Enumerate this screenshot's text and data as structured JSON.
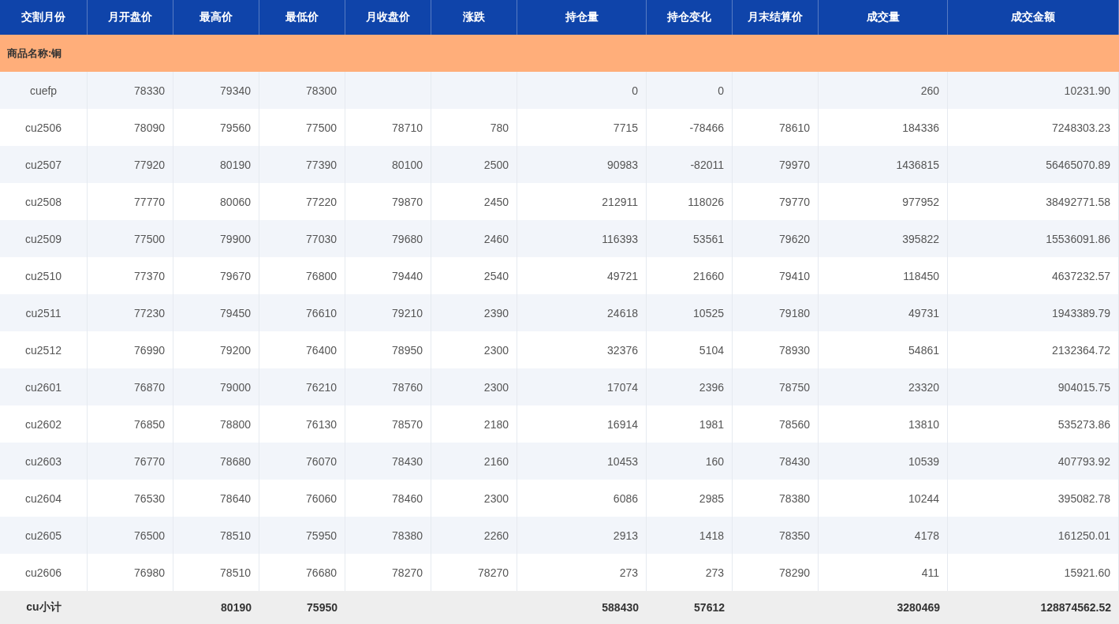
{
  "table": {
    "columns": [
      "交割月份",
      "月开盘价",
      "最高价",
      "最低价",
      "月收盘价",
      "涨跌",
      "持仓量",
      "持仓变化",
      "月末结算价",
      "成交量",
      "成交金额"
    ],
    "group": "商品名称:铜",
    "rows": [
      {
        "kind": "data",
        "cells": [
          "cuefp",
          "78330",
          "79340",
          "78300",
          null,
          null,
          "0",
          "0",
          null,
          "260",
          "10231.90"
        ]
      },
      {
        "kind": "data",
        "cells": [
          "cu2506",
          "78090",
          "79560",
          "77500",
          "78710",
          "780",
          "7715",
          "-78466",
          "78610",
          "184336",
          "7248303.23"
        ]
      },
      {
        "kind": "data",
        "cells": [
          "cu2507",
          "77920",
          "80190",
          "77390",
          "80100",
          "2500",
          "90983",
          "-82011",
          "79970",
          "1436815",
          "56465070.89"
        ]
      },
      {
        "kind": "data",
        "cells": [
          "cu2508",
          "77770",
          "80060",
          "77220",
          "79870",
          "2450",
          "212911",
          "118026",
          "79770",
          "977952",
          "38492771.58"
        ]
      },
      {
        "kind": "data",
        "cells": [
          "cu2509",
          "77500",
          "79900",
          "77030",
          "79680",
          "2460",
          "116393",
          "53561",
          "79620",
          "395822",
          "15536091.86"
        ]
      },
      {
        "kind": "data",
        "cells": [
          "cu2510",
          "77370",
          "79670",
          "76800",
          "79440",
          "2540",
          "49721",
          "21660",
          "79410",
          "118450",
          "4637232.57"
        ]
      },
      {
        "kind": "data",
        "cells": [
          "cu2511",
          "77230",
          "79450",
          "76610",
          "79210",
          "2390",
          "24618",
          "10525",
          "79180",
          "49731",
          "1943389.79"
        ]
      },
      {
        "kind": "data",
        "cells": [
          "cu2512",
          "76990",
          "79200",
          "76400",
          "78950",
          "2300",
          "32376",
          "5104",
          "78930",
          "54861",
          "2132364.72"
        ]
      },
      {
        "kind": "data",
        "cells": [
          "cu2601",
          "76870",
          "79000",
          "76210",
          "78760",
          "2300",
          "17074",
          "2396",
          "78750",
          "23320",
          "904015.75"
        ]
      },
      {
        "kind": "data",
        "cells": [
          "cu2602",
          "76850",
          "78800",
          "76130",
          "78570",
          "2180",
          "16914",
          "1981",
          "78560",
          "13810",
          "535273.86"
        ]
      },
      {
        "kind": "data",
        "cells": [
          "cu2603",
          "76770",
          "78680",
          "76070",
          "78430",
          "2160",
          "10453",
          "160",
          "78430",
          "10539",
          "407793.92"
        ]
      },
      {
        "kind": "data",
        "cells": [
          "cu2604",
          "76530",
          "78640",
          "76060",
          "78460",
          "2300",
          "6086",
          "2985",
          "78380",
          "10244",
          "395082.78"
        ]
      },
      {
        "kind": "data",
        "cells": [
          "cu2605",
          "76500",
          "78510",
          "75950",
          "78380",
          "2260",
          "2913",
          "1418",
          "78350",
          "4178",
          "161250.01"
        ]
      },
      {
        "kind": "data",
        "cells": [
          "cu2606",
          "76980",
          "78510",
          "76680",
          "78270",
          "78270",
          "273",
          "273",
          "78290",
          "411",
          "15921.60"
        ]
      },
      {
        "kind": "total",
        "cells": [
          "cu小计",
          null,
          "80190",
          "75950",
          null,
          null,
          "588430",
          "57612",
          null,
          "3280469",
          "128874562.52"
        ]
      }
    ]
  }
}
